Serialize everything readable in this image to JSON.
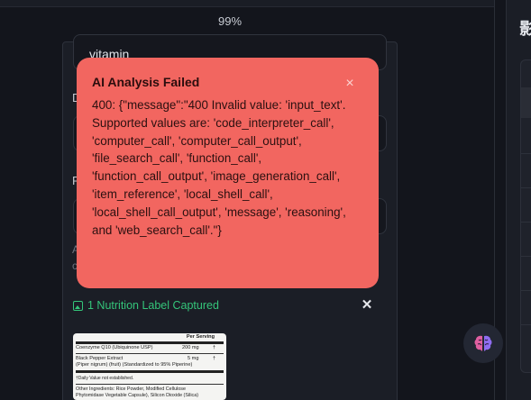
{
  "viewer": {
    "zoom_label": "99%"
  },
  "right_panel": {
    "heading_glyph": "影"
  },
  "form": {
    "name_value": "vitamin",
    "frag_label_1": "D",
    "frag_label_2": "F",
    "frag_small_1": "A",
    "frag_small_2": "c"
  },
  "capture": {
    "status_text": "1 Nutrition Label Captured",
    "close_glyph": "✕",
    "label_image": {
      "header": "Per Serving",
      "row1_name": "Coenzyme Q10 (Ubiquinone USP)",
      "row1_amount": "200 mg",
      "row1_dv": "†",
      "row2_name": "Black Pepper Extract",
      "row2_amount": "5 mg",
      "row2_dv": "†",
      "row2_detail": "(Piper nigrum) (fruit) (Standardized to 95% Piperine)",
      "footnote": "†Daily Value not established.",
      "ingredients_1": "Other Ingredients: Rice Powder, Modified Cellulose",
      "ingredients_2": "Phytomidase Vegetable Capsule), Silicon Dioxide (Silica)"
    }
  },
  "error_toast": {
    "title": "AI Analysis Failed",
    "message": "400: {\"message\":\"400 Invalid value: 'input_text'. Supported values are: 'code_interpreter_call', 'computer_call', 'computer_call_output', 'file_search_call', 'function_call', 'function_call_output', 'image_generation_call', 'item_reference', 'local_shell_call', 'local_shell_call_output', 'message', 'reasoning', and 'web_search_call'.\"}",
    "close_glyph": "×"
  },
  "colors": {
    "toast_bg": "#f26660",
    "success_green": "#34c57a",
    "app_bg": "#13151c"
  },
  "icons": {
    "assistant_fab": "brain-icon"
  }
}
